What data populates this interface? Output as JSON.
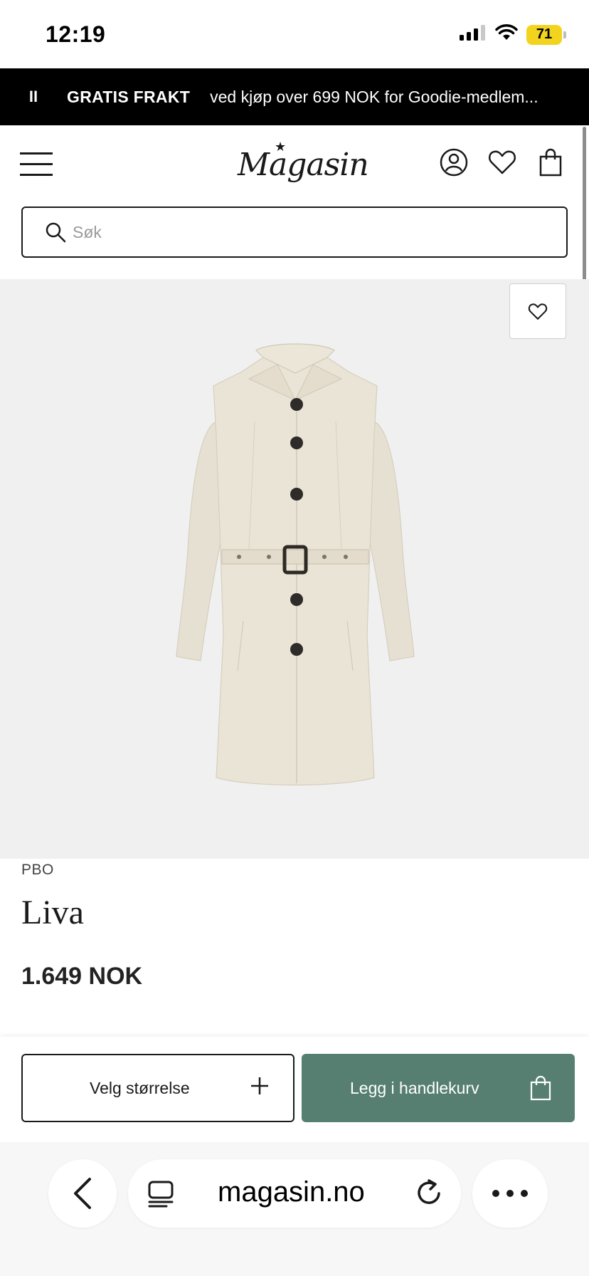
{
  "status_bar": {
    "time": "12:19",
    "battery_level": "71",
    "battery_color": "#f2d41f"
  },
  "promo": {
    "pause_symbol": "II",
    "highlight": "GRATIS FRAKT",
    "text": "ved kjøp over 699 NOK for Goodie-medlem..."
  },
  "header": {
    "logo_text": "Magasin",
    "logo_star": "★",
    "icons": [
      "menu-icon",
      "account-icon",
      "heart-icon",
      "shopping-bag-icon"
    ]
  },
  "search": {
    "placeholder": "Søk",
    "value": ""
  },
  "product": {
    "brand": "PBO",
    "name": "Liva",
    "price": "1.649 NOK",
    "image_background": "#f0f0f0"
  },
  "actions": {
    "size_label": "Velg størrelse",
    "cart_label": "Legg i handlekurv",
    "accent_color": "#567f72"
  },
  "browser": {
    "url": "magasin.no"
  }
}
